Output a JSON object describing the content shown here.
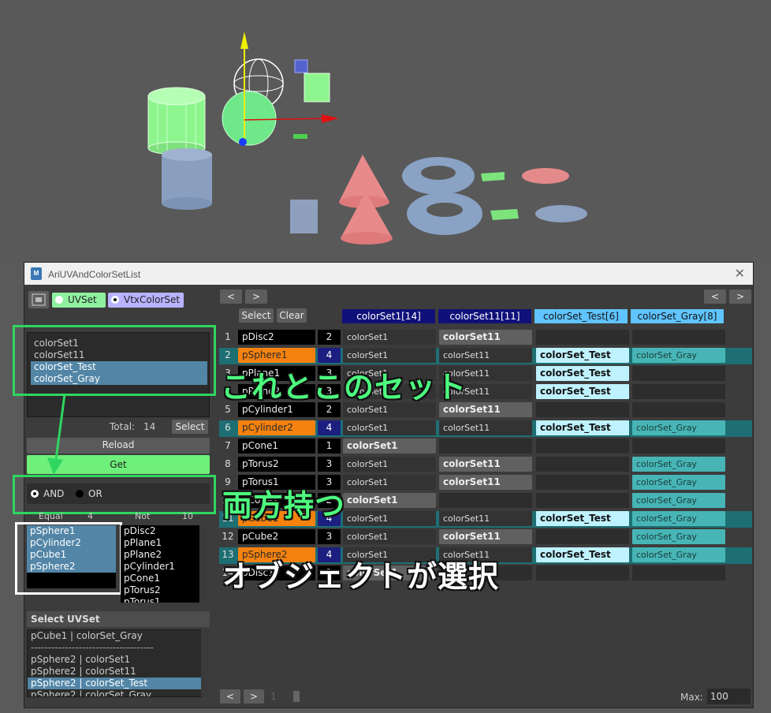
{
  "window": {
    "title": "AriUVAndColorSetList",
    "close": "✕"
  },
  "mode": {
    "uvset": "UVSet",
    "vtxcolorset": "VtxColorSet"
  },
  "left": {
    "colorsets": [
      "colorSet1",
      "colorSet11",
      "colorSet_Test",
      "colorSet_Gray"
    ],
    "total_label": "Total:",
    "total_value": "14",
    "select_label": "Select",
    "reload_label": "Reload",
    "get_label": "Get",
    "and_label": "AND",
    "or_label": "OR",
    "equal_label": "Equal",
    "equal_count": "4",
    "not_label": "Not",
    "not_count": "10",
    "equal_list": [
      "pSphere1",
      "pCylinder2",
      "pCube1",
      "pSphere2"
    ],
    "not_list": [
      "pDisc2",
      "pPlane1",
      "pPlane2",
      "pCylinder1",
      "pCone1",
      "pTorus2",
      "pTorus1"
    ],
    "select_uvset_header": "Select UVSet",
    "uvset_list": [
      "pCube1 | colorSet_Gray",
      "------------------------------------",
      "pSphere2 | colorSet1",
      "pSphere2 | colorSet11",
      "pSphere2 | colorSet_Test",
      "pSphere2 | colorSet_Gray"
    ]
  },
  "grid": {
    "prev": "<",
    "next": ">",
    "select_label": "Select",
    "clear_label": "Clear",
    "headers": [
      "colorSet1[14]",
      "colorSet11[11]",
      "colorSet_Test[6]",
      "colorSet_Gray[8]"
    ],
    "rows": [
      {
        "n": "1",
        "obj": "pDisc2",
        "cnt": "2",
        "cs1": "colorSet1",
        "cs11": "colorSet11",
        "cst": "",
        "csg": ""
      },
      {
        "n": "2",
        "obj": "pSphere1",
        "cnt": "4",
        "cs1": "colorSet1",
        "cs11": "colorSet11",
        "cst": "colorSet_Test",
        "csg": "colorSet_Gray"
      },
      {
        "n": "3",
        "obj": "pPlane1",
        "cnt": "3",
        "cs1": "colorSet1",
        "cs11": "colorSet11",
        "cst": "colorSet_Test",
        "csg": ""
      },
      {
        "n": "4",
        "obj": "pPlane2",
        "cnt": "3",
        "cs1": "colorSet1",
        "cs11": "colorSet11",
        "cst": "colorSet_Test",
        "csg": ""
      },
      {
        "n": "5",
        "obj": "pCylinder1",
        "cnt": "2",
        "cs1": "colorSet1",
        "cs11": "colorSet11",
        "cst": "",
        "csg": ""
      },
      {
        "n": "6",
        "obj": "pCylinder2",
        "cnt": "4",
        "cs1": "colorSet1",
        "cs11": "colorSet11",
        "cst": "colorSet_Test",
        "csg": "colorSet_Gray"
      },
      {
        "n": "7",
        "obj": "pCone1",
        "cnt": "1",
        "cs1": "colorSet1",
        "cs11": "",
        "cst": "",
        "csg": ""
      },
      {
        "n": "8",
        "obj": "pTorus2",
        "cnt": "3",
        "cs1": "colorSet1",
        "cs11": "colorSet11",
        "cst": "",
        "csg": "colorSet_Gray"
      },
      {
        "n": "9",
        "obj": "pTorus1",
        "cnt": "3",
        "cs1": "colorSet1",
        "cs11": "colorSet11",
        "cst": "",
        "csg": "colorSet_Gray"
      },
      {
        "n": "10",
        "obj": "pCone2",
        "cnt": "2",
        "cs1": "colorSet1",
        "cs11": "",
        "cst": "",
        "csg": "colorSet_Gray"
      },
      {
        "n": "11",
        "obj": "pCube1",
        "cnt": "4",
        "cs1": "colorSet1",
        "cs11": "colorSet11",
        "cst": "colorSet_Test",
        "csg": "colorSet_Gray"
      },
      {
        "n": "12",
        "obj": "pCube2",
        "cnt": "3",
        "cs1": "colorSet1",
        "cs11": "colorSet11",
        "cst": "",
        "csg": "colorSet_Gray"
      },
      {
        "n": "13",
        "obj": "pSphere2",
        "cnt": "4",
        "cs1": "colorSet1",
        "cs11": "colorSet11",
        "cst": "colorSet_Test",
        "csg": "colorSet_Gray"
      },
      {
        "n": "14",
        "obj": "pDisc1",
        "cnt": "1",
        "cs1": "colorSet1",
        "cs11": "",
        "cst": "",
        "csg": ""
      }
    ],
    "max_label": "Max:",
    "max_value": "100",
    "page_value": "1"
  },
  "annotations": {
    "a1": "これとこのセット",
    "a2": "両方持つ",
    "a3": "オブジェクトが選択"
  },
  "colors": {
    "accent_green": "#2fd660",
    "orange": "#f5820f",
    "navy": "#1d1f80",
    "teal": "#47b5b6",
    "lightblue": "#bff2ff"
  }
}
